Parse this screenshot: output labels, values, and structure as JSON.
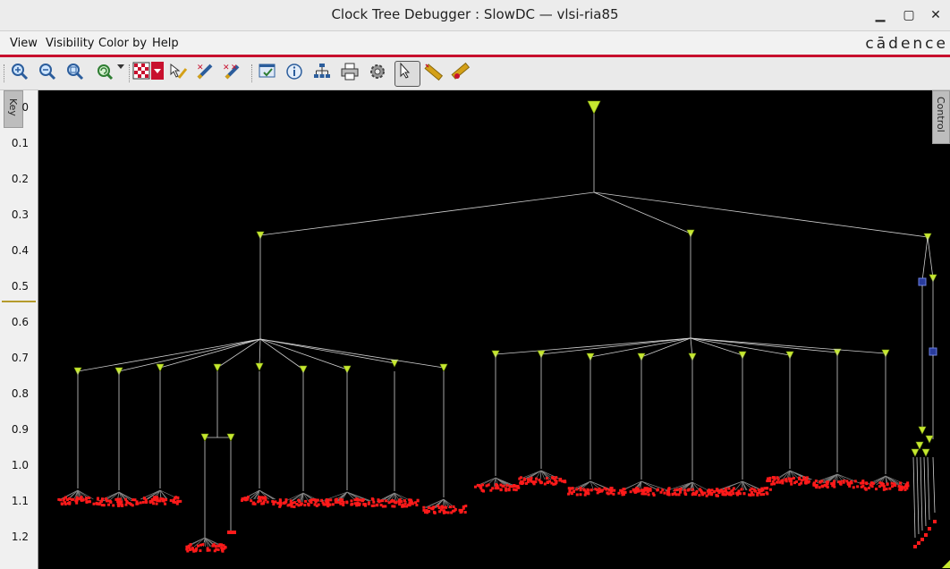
{
  "window": {
    "title": "Clock Tree Debugger : SlowDC — vlsi-ria85",
    "minimize": "🗕",
    "maximize": "🗖",
    "close": "✕"
  },
  "menu": {
    "items": [
      "View",
      "Visibility",
      "Color by",
      "Help"
    ],
    "brand": "cādence"
  },
  "toolbar": {
    "icons": [
      "zoom-in-icon",
      "zoom-out-icon",
      "zoom-fit-icon",
      "refresh-icon",
      "dropdown-arrow-icon",
      "checker-pattern-icon",
      "color-dropdown-icon",
      "select-pen-icon",
      "highlight-pen-icon",
      "clear-pen-icon",
      "window-check-icon",
      "info-icon",
      "hierarchy-icon",
      "print-icon",
      "settings-icon",
      "pointer-icon",
      "ruler-icon",
      "ruler-clear-icon"
    ]
  },
  "side": {
    "key_tab": "Key",
    "control_tab": "Control"
  },
  "axis": {
    "ticks": [
      "0",
      "0.1",
      "0.2",
      "0.3",
      "0.4",
      "0.5",
      "0.6",
      "0.7",
      "0.8",
      "0.9",
      "1.0",
      "1.1",
      "1.2"
    ]
  },
  "tree": {
    "line_color": "#cfcfcf",
    "buffer_color": "#c6e830",
    "sink_color": "#ff1a1a",
    "module_color": "#2a3c9c"
  }
}
